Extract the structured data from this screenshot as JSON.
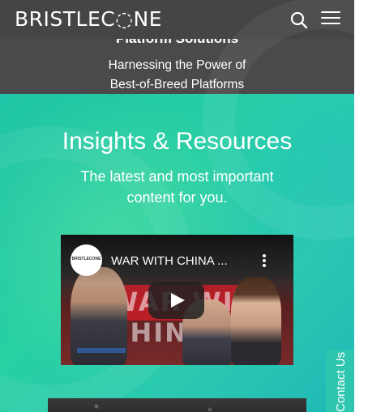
{
  "header": {
    "logo_text": "BRISTLEC◌NE",
    "search_icon": "search-icon",
    "menu_icon": "hamburger-menu-icon"
  },
  "hero": {
    "title": "Platform Solutions",
    "subtitle_line1": "Harnessing the Power of",
    "subtitle_line2": "Best-of-Breed Platforms"
  },
  "insights": {
    "title": "Insights & Resources",
    "subtitle_line1": "The latest and most important",
    "subtitle_line2": "content for you."
  },
  "video": {
    "channel_label": "BRISTLECONE",
    "title": "WAR WITH CHINA ...",
    "thumbnail_banner": "WAR WITH CHINA",
    "play_icon": "play-icon",
    "more_icon": "more-vertical-icon"
  },
  "contact": {
    "label": "Contact Us"
  },
  "colors": {
    "header_bg": "#454547",
    "teal": "#28d0a2",
    "play_button": "#212121"
  }
}
